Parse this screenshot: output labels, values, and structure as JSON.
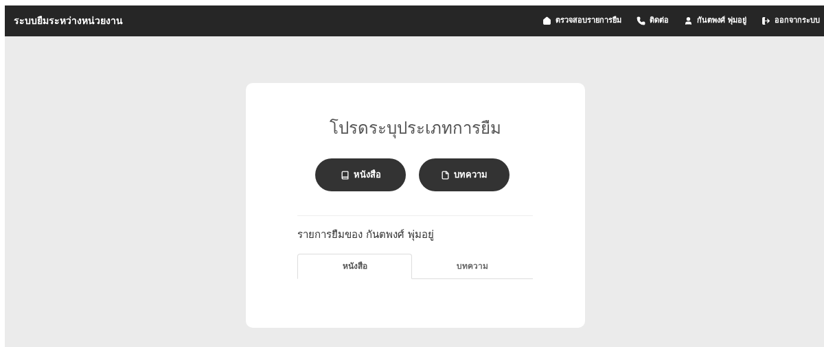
{
  "navbar": {
    "brand": "ระบบยืมระหว่างหน่วยงาน",
    "links": [
      {
        "kind": "home",
        "label": "ตรวจสอบรายการยืม"
      },
      {
        "kind": "phone",
        "label": "ติดต่อ"
      },
      {
        "kind": "user",
        "label": "กันตพงศ์ พุ่มอยู่"
      },
      {
        "kind": "logout",
        "label": "ออกจากระบบ"
      }
    ]
  },
  "card": {
    "title": "โปรดระบุประเภทการยืม",
    "buttons": [
      {
        "kind": "book",
        "label": "หนังสือ"
      },
      {
        "kind": "file",
        "label": "บทความ"
      }
    ],
    "list_heading": "รายการยืมของ กันตพงศ์ พุ่มอยู่",
    "tabs": [
      {
        "label": "หนังสือ",
        "selected": true
      },
      {
        "label": "บทความ",
        "selected": false
      }
    ]
  }
}
